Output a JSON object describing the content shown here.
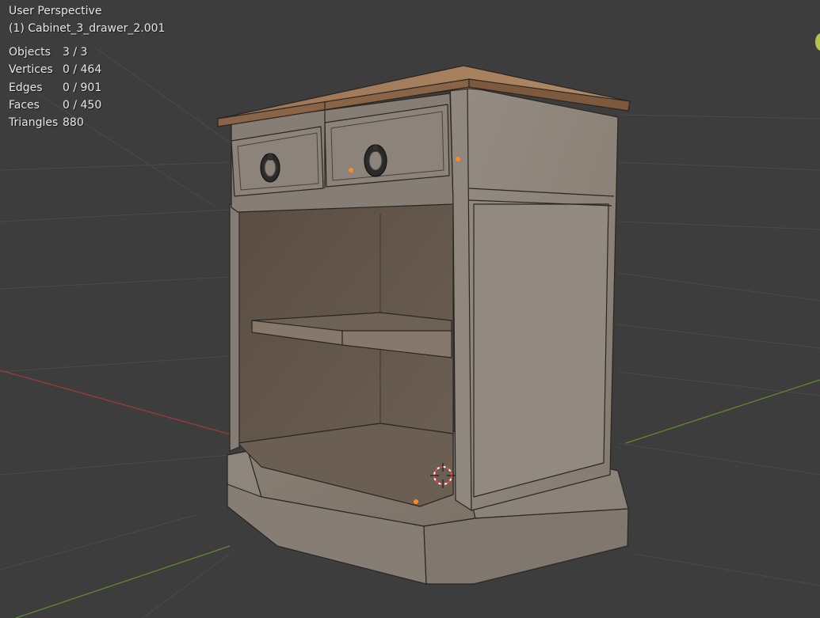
{
  "viewport": {
    "view_name": "User Perspective",
    "object_name": "(1) Cabinet_3_drawer_2.001"
  },
  "stats": [
    {
      "label": "Objects",
      "value": "3 / 3"
    },
    {
      "label": "Vertices",
      "value": "0 / 464"
    },
    {
      "label": "Edges",
      "value": "0 / 901"
    },
    {
      "label": "Faces",
      "value": "0 / 450"
    },
    {
      "label": "Triangles",
      "value": "880"
    }
  ],
  "colors": {
    "background": "#3d3d3d",
    "grid": "#4a4a4a",
    "x_axis": "#9c3a3a",
    "y_axis": "#5f8a2e",
    "wood_top": "#8a6446",
    "cabinet_side": "#8f877e",
    "cabinet_front": "#857d74",
    "interior": "#5c5045",
    "origin_dot": "#ff8a1f",
    "cursor_red": "#ff3b3b"
  },
  "icons": {
    "cursor": "3d-cursor-icon",
    "origin": "object-origin-icon",
    "gizmo": "navigation-gizmo-icon"
  }
}
